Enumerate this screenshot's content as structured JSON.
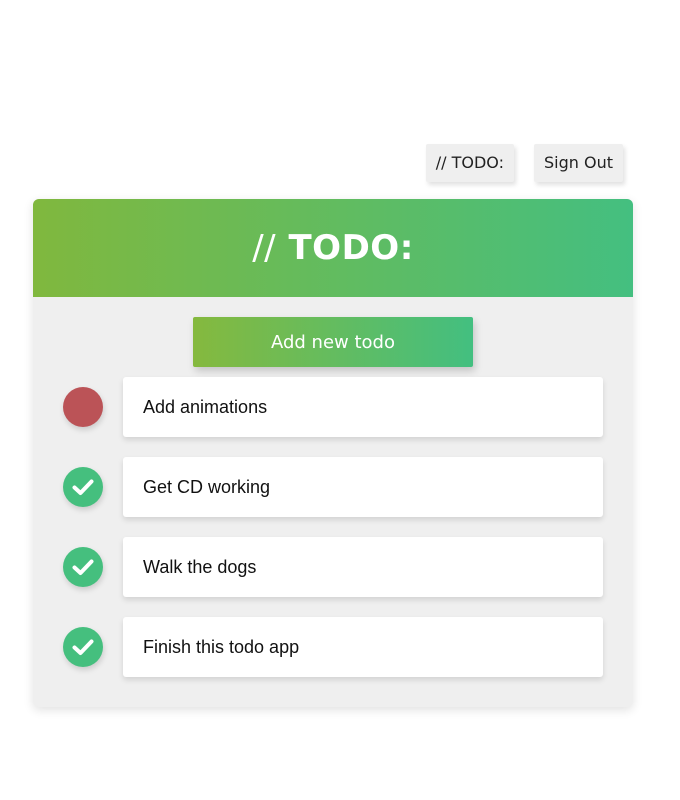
{
  "nav": {
    "home_label": "// TODO:",
    "signout_label": "Sign Out"
  },
  "card": {
    "title_slashes": "//",
    "title_word": "TODO:",
    "add_button_label": "Add new todo"
  },
  "todos": [
    {
      "text": "Add animations",
      "done": false
    },
    {
      "text": "Get CD working",
      "done": true
    },
    {
      "text": "Walk the dogs",
      "done": true
    },
    {
      "text": "Finish this todo app",
      "done": true
    }
  ],
  "colors": {
    "accent_green": "#45bf7e",
    "accent_lime": "#80b83e",
    "pending_red": "#bb5357"
  },
  "icons": {
    "done": "check-icon"
  }
}
